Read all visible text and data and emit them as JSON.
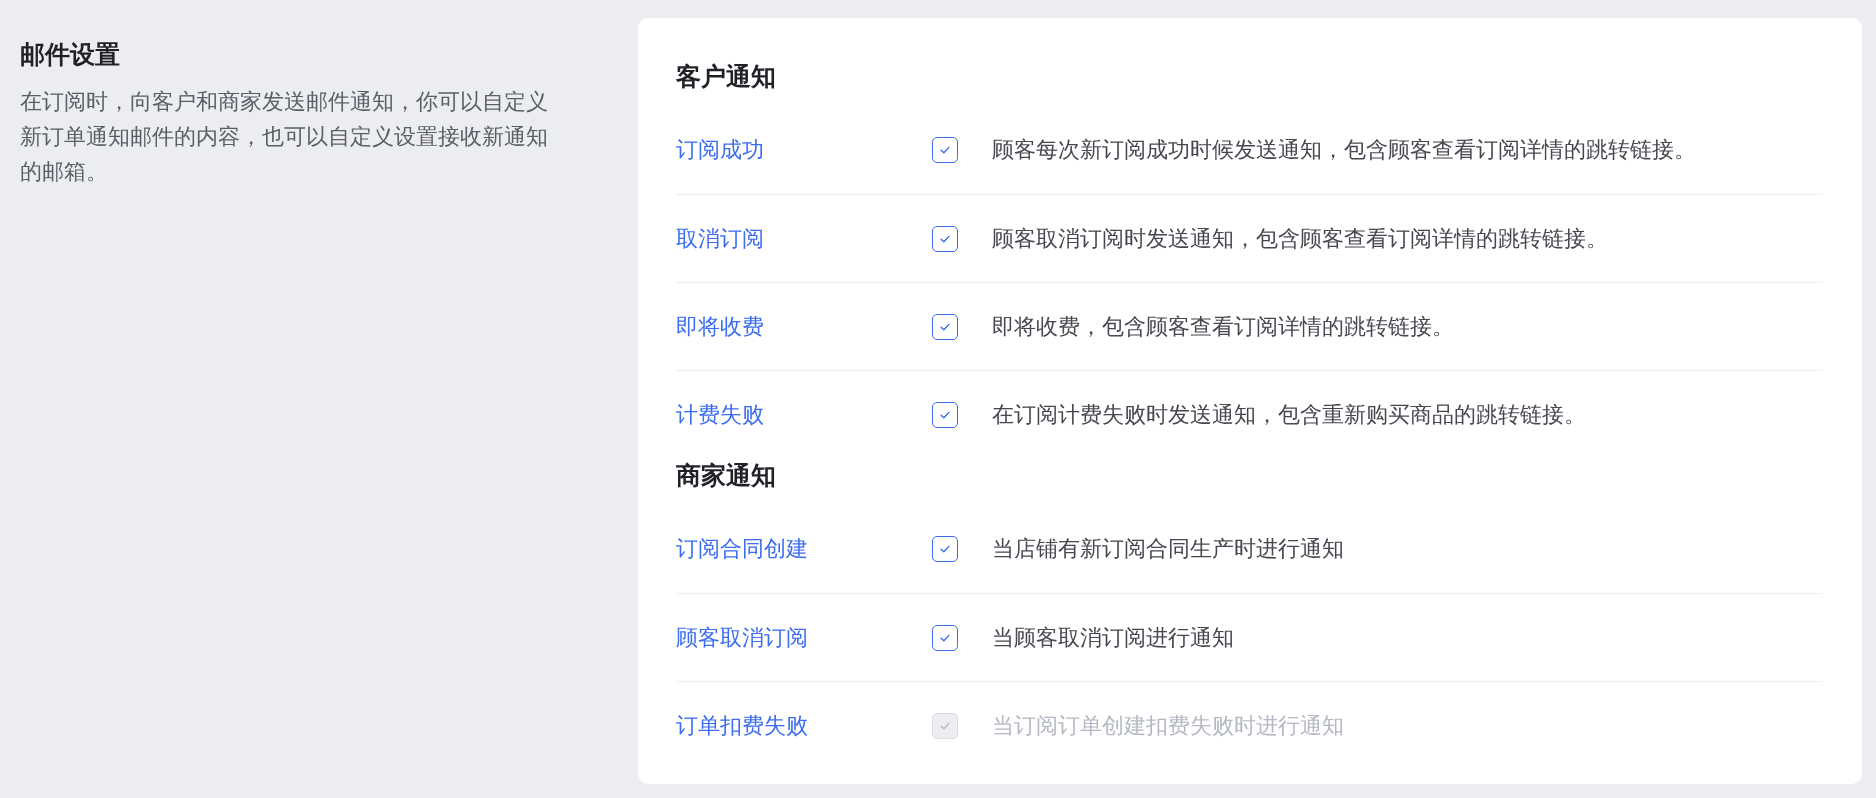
{
  "intro": {
    "title": "邮件设置",
    "description": "在订阅时，向客户和商家发送邮件通知，你可以自定义新订单通知邮件的内容，也可以自定义设置接收新通知的邮箱。"
  },
  "sections": [
    {
      "title": "客户通知",
      "items": [
        {
          "label": "订阅成功",
          "checked": true,
          "disabled": false,
          "description": "顾客每次新订阅成功时候发送通知，包含顾客查看订阅详情的跳转链接。"
        },
        {
          "label": "取消订阅",
          "checked": true,
          "disabled": false,
          "description": "顾客取消订阅时发送通知，包含顾客查看订阅详情的跳转链接。"
        },
        {
          "label": "即将收费",
          "checked": true,
          "disabled": false,
          "description": "即将收费，包含顾客查看订阅详情的跳转链接。"
        },
        {
          "label": "计费失败",
          "checked": true,
          "disabled": false,
          "description": "在订阅计费失败时发送通知，包含重新购买商品的跳转链接。"
        }
      ]
    },
    {
      "title": "商家通知",
      "items": [
        {
          "label": "订阅合同创建",
          "checked": true,
          "disabled": false,
          "description": "当店铺有新订阅合同生产时进行通知"
        },
        {
          "label": "顾客取消订阅",
          "checked": true,
          "disabled": false,
          "description": "当顾客取消订阅进行通知"
        },
        {
          "label": "订单扣费失败",
          "checked": true,
          "disabled": true,
          "description": "当订阅订单创建扣费失败时进行通知"
        }
      ]
    }
  ]
}
